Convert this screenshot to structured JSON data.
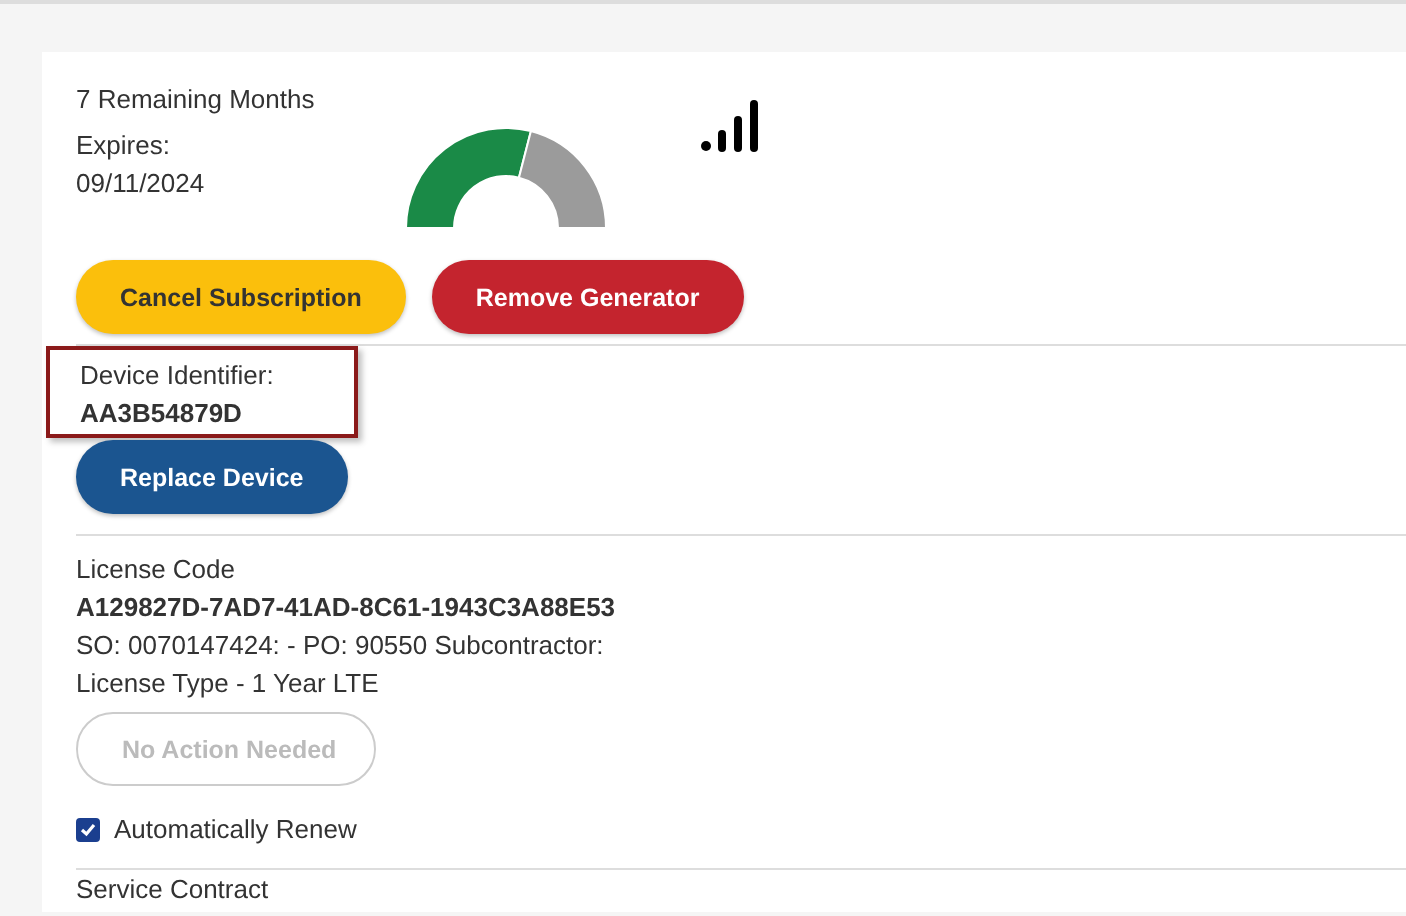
{
  "subscription": {
    "remaining": "7 Remaining Months",
    "expires_label": "Expires:",
    "expires_date": "09/11/2024",
    "gauge": {
      "level": 0.58
    }
  },
  "actions": [
    {
      "label": "Cancel Subscription",
      "kind": "warning"
    },
    {
      "label": "Remove Generator",
      "kind": "danger"
    }
  ],
  "device": {
    "label": "Device Identifier:",
    "value": "AA3B54879D",
    "highlighted": true,
    "button": {
      "label": "Replace Device",
      "kind": "primary"
    }
  },
  "license": {
    "label": "License Code",
    "code": "A129827D-7AD7-41AD-8C61-1943C3A88E53",
    "order": "SO: 0070147424: - PO: 90550 Subcontractor:",
    "type": "License Type - 1 Year LTE",
    "button": {
      "label": "No Action Needed",
      "disabled": true
    },
    "auto_renew": {
      "label": "Automatically Renew",
      "checked": true
    }
  },
  "next_section": {
    "title": "Service Contract"
  }
}
